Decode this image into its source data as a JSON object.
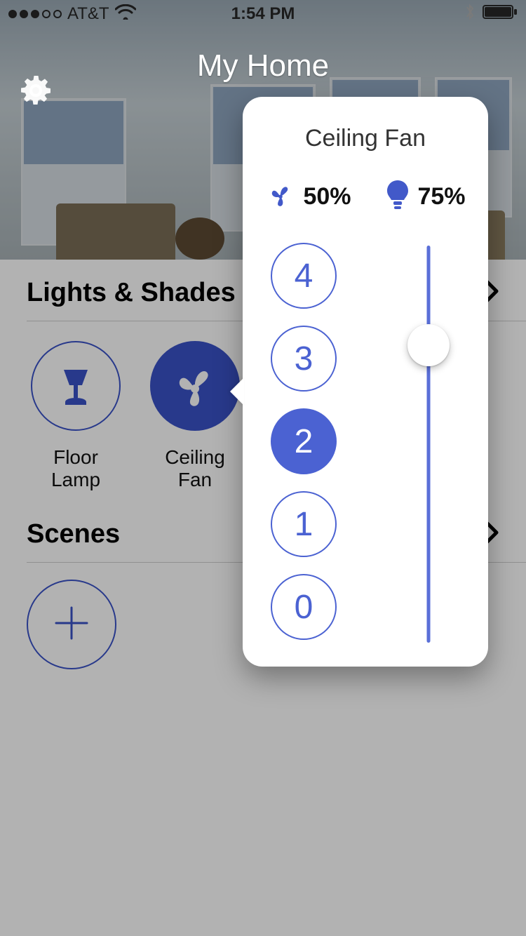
{
  "status": {
    "carrier": "AT&T",
    "time": "1:54 PM",
    "signal_filled": 3,
    "signal_total": 5
  },
  "header": {
    "title": "My Home"
  },
  "sections": {
    "lights": {
      "title": "Lights & Shades"
    },
    "scenes": {
      "title": "Scenes"
    }
  },
  "devices": [
    {
      "id": "floor-lamp",
      "label": "Floor Lamp",
      "icon": "lamp",
      "selected": false
    },
    {
      "id": "ceiling-fan",
      "label": "Ceiling Fan",
      "icon": "fan",
      "selected": true
    }
  ],
  "popover": {
    "title": "Ceiling Fan",
    "fan": {
      "percent": "50%"
    },
    "light": {
      "percent": "75%",
      "slider_value": 75
    },
    "speeds": {
      "options": [
        "4",
        "3",
        "2",
        "1",
        "0"
      ],
      "selected": "2"
    }
  },
  "colors": {
    "accent": "#4b62d2"
  }
}
